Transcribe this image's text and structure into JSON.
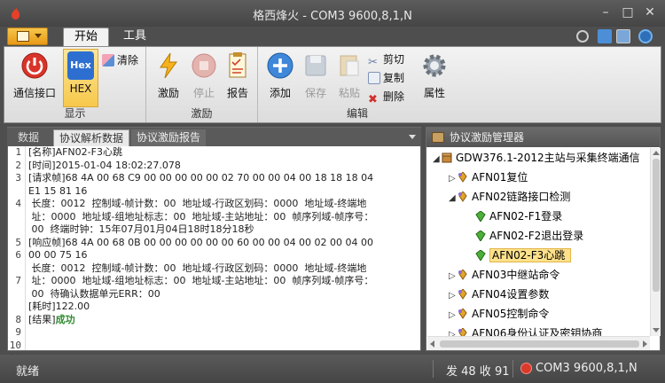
{
  "window": {
    "title": "格西烽火 - COM3  9600,8,1,N"
  },
  "ribbon": {
    "tabs": [
      "开始",
      "工具"
    ],
    "groups": {
      "display": {
        "label": "显示",
        "comm_label": "通信接口",
        "hex_label": "HEX",
        "clear_label": "清除"
      },
      "stimulus": {
        "label": "激励",
        "stimulate_label": "激励",
        "stop_label": "停止",
        "report_label": "报告"
      },
      "edit": {
        "label": "编辑",
        "add_label": "添加",
        "save_label": "保存",
        "paste_label": "粘贴",
        "cut_label": "剪切",
        "copy_label": "复制",
        "delete_label": "删除",
        "props_label": "属性"
      }
    }
  },
  "left_panel": {
    "tabs": [
      "数据",
      "协议解析数据",
      "协议激励报告"
    ],
    "line_numbers": [
      "1",
      "2",
      "3",
      "",
      "4",
      "",
      "",
      "5",
      "6",
      "",
      "7",
      "",
      "",
      "8",
      "9",
      "10",
      "11"
    ],
    "lines": [
      "[名称]AFN02-F3心跳",
      "[时间]2015-01-04 18:02:27.078",
      "[请求帧]68 4A 00 68 C9 00 00 00 00 00 02 70 00 00 04 00 18 18 18 04",
      "E1 15 81 16",
      " 长度：0012  控制域-帧计数：00  地址域-行政区划码：0000  地址域-终端地",
      " 址：0000  地址域-组地址标志：00  地址域-主站地址：00  帧序列域-帧序号：",
      " 00  终端时钟：15年07月01月04日18时18分18秒",
      "[响应帧]68 4A 00 68 0B 00 00 00 00 00 00 60 00 00 04 00 02 00 04 00",
      "00 00 75 16",
      " 长度：0012  控制域-帧计数：00  地址域-行政区划码：0000  地址域-终端地",
      " 址：0000  地址域-组地址标志：00  地址域-主站地址：00  帧序列域-帧序号：",
      " 00  待确认数据单元ERR：00",
      "[耗时]122.00",
      "[结果]",
      "",
      "",
      ""
    ],
    "result_value": "成功"
  },
  "right_panel": {
    "title": "协议激励管理器",
    "tree": [
      {
        "label": "GDW376.1-2012主站与采集终端通信",
        "level": 0,
        "expander": "◢",
        "icon": "box-icon"
      },
      {
        "label": "AFN01复位",
        "level": 1,
        "expander": "▷",
        "icon": "diamond-icon"
      },
      {
        "label": "AFN02链路接口检测",
        "level": 1,
        "expander": "◢",
        "icon": "diamond-icon"
      },
      {
        "label": "AFN02-F1登录",
        "level": 2,
        "expander": "",
        "icon": "green-gem-icon"
      },
      {
        "label": "AFN02-F2退出登录",
        "level": 2,
        "expander": "",
        "icon": "green-gem-icon"
      },
      {
        "label": "AFN02-F3心跳",
        "level": 2,
        "expander": "",
        "icon": "green-gem-icon",
        "selected": true
      },
      {
        "label": "AFN03中继站命令",
        "level": 1,
        "expander": "▷",
        "icon": "diamond-icon"
      },
      {
        "label": "AFN04设置参数",
        "level": 1,
        "expander": "▷",
        "icon": "diamond-icon"
      },
      {
        "label": "AFN05控制命令",
        "level": 1,
        "expander": "▷",
        "icon": "diamond-icon"
      },
      {
        "label": "AFN06身份认证及密钥协商",
        "level": 1,
        "expander": "▷",
        "icon": "diamond-icon"
      }
    ]
  },
  "status": {
    "ready": "就绪",
    "tx_rx": "发 48  收 91",
    "port": "COM3  9600,8,1,N"
  },
  "colors": {
    "accent": "#f2b233",
    "selection": "#fde18b",
    "success": "#2f8a2f",
    "port_status": "#d93a2a"
  }
}
